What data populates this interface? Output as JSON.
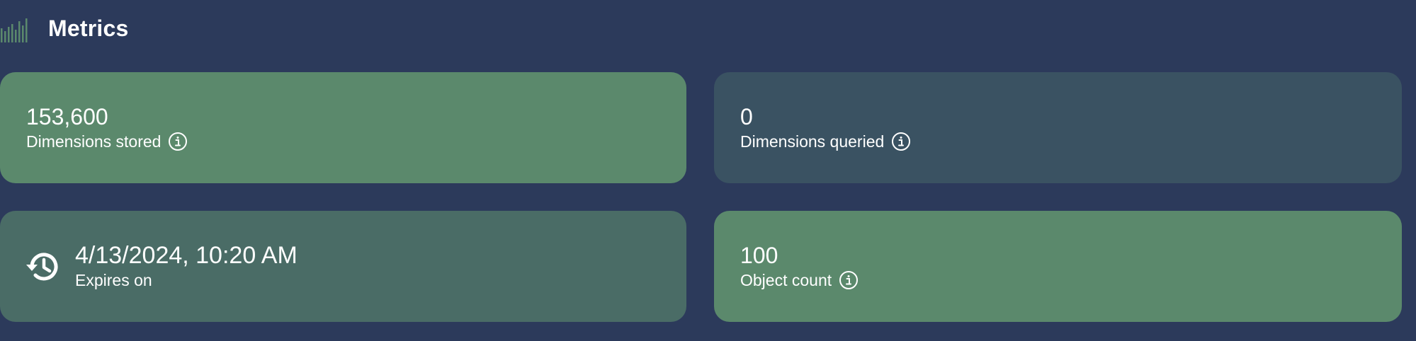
{
  "header": {
    "title": "Metrics",
    "icon": "bar-chart-icon"
  },
  "cards": [
    {
      "value": "153,600",
      "label": "Dimensions stored",
      "icon": "info-icon",
      "color": "#5b896c"
    },
    {
      "value": "0",
      "label": "Dimensions queried",
      "icon": "info-icon",
      "color": "#3a5262"
    },
    {
      "value": "4/13/2024, 10:20 AM",
      "label": "Expires on",
      "icon": "history-icon",
      "color": "#4a6c66"
    },
    {
      "value": "100",
      "label": "Object count",
      "icon": "info-icon",
      "color": "#5b896c"
    }
  ],
  "colors": {
    "background": "#2c3a5b",
    "accent_green": "#5b896c",
    "slate": "#3a5262",
    "teal": "#4a6c66"
  }
}
